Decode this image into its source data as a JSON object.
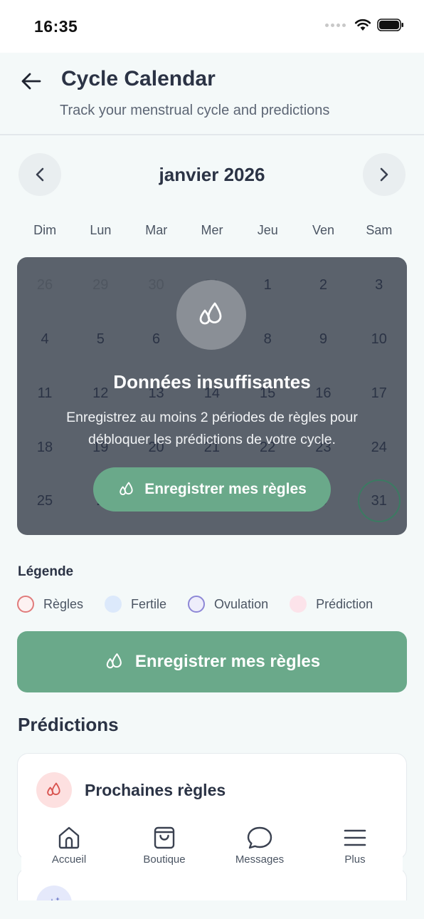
{
  "status_bar": {
    "time": "16:35"
  },
  "header": {
    "title": "Cycle Calendar",
    "subtitle": "Track your menstrual cycle and predictions"
  },
  "calendar": {
    "month_label": "janvier 2026",
    "weekdays": [
      "Dim",
      "Lun",
      "Mar",
      "Mer",
      "Jeu",
      "Ven",
      "Sam"
    ],
    "weeks": [
      [
        "26",
        "29",
        "30",
        "31",
        "1",
        "2",
        "3"
      ],
      [
        "4",
        "5",
        "6",
        "7",
        "8",
        "9",
        "10"
      ],
      [
        "11",
        "12",
        "13",
        "14",
        "15",
        "16",
        "17"
      ],
      [
        "18",
        "19",
        "20",
        "21",
        "22",
        "23",
        "24"
      ],
      [
        "25",
        "2",
        "",
        "",
        "",
        "0",
        "31"
      ]
    ],
    "today": "31"
  },
  "overlay": {
    "title": "Données insuffisantes",
    "description": "Enregistrez au moins 2 périodes de règles pour débloquer les prédictions de votre cycle.",
    "button_label": "Enregistrer mes règles"
  },
  "legend": {
    "title": "Légende",
    "items": [
      {
        "label": "Règles",
        "color": "#e07b7b"
      },
      {
        "label": "Fertile",
        "color": "#dce9fb"
      },
      {
        "label": "Ovulation",
        "color": "#8d87d6"
      },
      {
        "label": "Prédiction",
        "color": "#fce3ea"
      }
    ]
  },
  "main_button": {
    "label": "Enregistrer mes règles",
    "color": "#6aa98a"
  },
  "predictions": {
    "title": "Prédictions",
    "cards": [
      {
        "label": "Prochaines règles",
        "icon": "drop-icon"
      },
      {
        "label": "",
        "icon": "sparkle-icon"
      }
    ]
  },
  "tab_bar": {
    "tabs": [
      {
        "label": "Accueil",
        "icon": "home-icon"
      },
      {
        "label": "Boutique",
        "icon": "shopping-bag-icon"
      },
      {
        "label": "Messages",
        "icon": "chat-bubble-icon"
      },
      {
        "label": "Plus",
        "icon": "menu-icon"
      }
    ]
  }
}
